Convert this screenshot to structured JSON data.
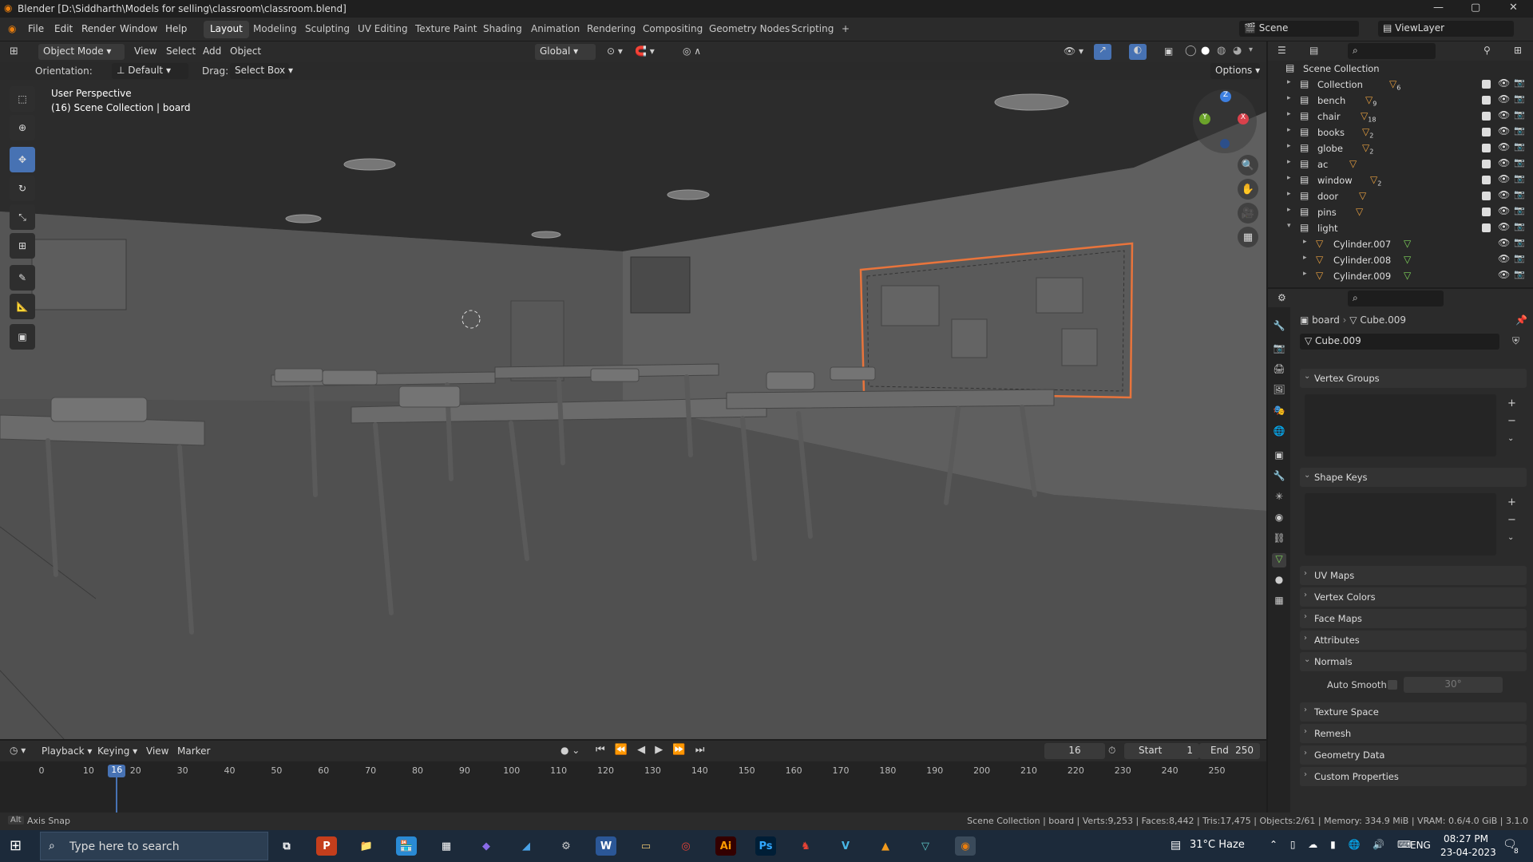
{
  "titlebar": {
    "title": "Blender [D:\\Siddharth\\Models for selling\\classroom\\classroom.blend]",
    "min": "—",
    "max": "▢",
    "close": "✕"
  },
  "menu": {
    "file": "File",
    "edit": "Edit",
    "render": "Render",
    "window": "Window",
    "help": "Help"
  },
  "workspaces": [
    "Layout",
    "Modeling",
    "Sculpting",
    "UV Editing",
    "Texture Paint",
    "Shading",
    "Animation",
    "Rendering",
    "Compositing",
    "Geometry Nodes",
    "Scripting"
  ],
  "workspace_add": "+",
  "scene": {
    "label": "Scene",
    "viewlayer": "ViewLayer"
  },
  "viewport_header": {
    "mode": "Object Mode",
    "view": "View",
    "select": "Select",
    "add": "Add",
    "object": "Object",
    "transform": "Global"
  },
  "viewport_sub": {
    "orientation_label": "Orientation:",
    "orientation": "Default",
    "drag_label": "Drag:",
    "drag": "Select Box",
    "options": "Options"
  },
  "viewport_overlay": {
    "perspective": "User Perspective",
    "collection": "(16) Scene Collection | board"
  },
  "gizmo": {
    "x": "X",
    "y": "Y",
    "z": "Z"
  },
  "outliner": {
    "root": "Scene Collection",
    "items": [
      {
        "name": "Collection",
        "count": "6"
      },
      {
        "name": "bench",
        "count": "9"
      },
      {
        "name": "chair",
        "count": "18"
      },
      {
        "name": "books",
        "count": "2"
      },
      {
        "name": "globe",
        "count": "2"
      },
      {
        "name": "ac",
        "count": ""
      },
      {
        "name": "window",
        "count": "2"
      },
      {
        "name": "door",
        "count": ""
      },
      {
        "name": "pins",
        "count": ""
      },
      {
        "name": "light",
        "count": ""
      }
    ],
    "children": [
      "Cylinder.007",
      "Cylinder.008",
      "Cylinder.009"
    ]
  },
  "properties": {
    "breadcrumb_object": "board",
    "breadcrumb_mesh": "Cube.009",
    "mesh_name": "Cube.009",
    "panels": {
      "vertex_groups": "Vertex Groups",
      "shape_keys": "Shape Keys",
      "uv_maps": "UV Maps",
      "vertex_colors": "Vertex Colors",
      "face_maps": "Face Maps",
      "attributes": "Attributes",
      "normals": "Normals",
      "auto_smooth": "Auto Smooth",
      "auto_smooth_angle": "30°",
      "texture_space": "Texture Space",
      "remesh": "Remesh",
      "geometry_data": "Geometry Data",
      "custom_properties": "Custom Properties"
    }
  },
  "timeline": {
    "playback": "Playback",
    "keying": "Keying",
    "view": "View",
    "marker": "Marker",
    "current_frame": "16",
    "start_label": "Start",
    "start": "1",
    "end_label": "End",
    "end": "250",
    "ticks": [
      "0",
      "10",
      "20",
      "30",
      "40",
      "50",
      "60",
      "70",
      "80",
      "90",
      "100",
      "110",
      "120",
      "130",
      "140",
      "150",
      "160",
      "170",
      "180",
      "190",
      "200",
      "210",
      "220",
      "230",
      "240",
      "250"
    ],
    "current": 16,
    "frame_max": 250
  },
  "statusbar": {
    "left": "Axis Snap",
    "right": "Scene Collection | board | Verts:9,253 | Faces:8,442 | Tris:17,475 | Objects:2/61 | Memory: 334.9 MiB | VRAM: 0.6/4.0 GiB | 3.1.0"
  },
  "taskbar": {
    "search_placeholder": "Type here to search",
    "weather": "31°C  Haze",
    "lang": "ENG",
    "time": "08:27 PM",
    "date": "23-04-2023",
    "notifications": "8",
    "apps": [
      "P",
      "📁",
      "🏪",
      "W",
      "Ai",
      "Ps",
      "V"
    ]
  },
  "colors": {
    "accent": "#4772b3",
    "selection": "#e8743c",
    "header": "#2b2b2b",
    "panel": "#282828"
  }
}
